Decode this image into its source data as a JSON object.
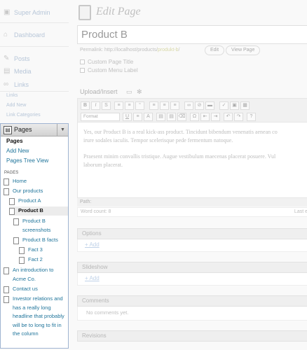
{
  "sidebar": {
    "super_admin": "Super Admin",
    "dashboard": "Dashboard",
    "posts": "Posts",
    "media": "Media",
    "links": "Links",
    "links_sub": [
      "Links",
      "Add New",
      "Link Categories"
    ],
    "pages": {
      "title": "Pages",
      "toggle_icon": "▼",
      "subnav": {
        "current": "Pages",
        "add_new": "Add New",
        "tree_view": "Pages Tree View"
      },
      "section_label": "PAGES",
      "tree": [
        {
          "label": "Home"
        },
        {
          "label": "Our products"
        },
        {
          "label": "Product A"
        },
        {
          "label": "Product B"
        },
        {
          "label": "Product B screenshots"
        },
        {
          "label": "Product B facts"
        },
        {
          "label": "Fact 3"
        },
        {
          "label": "Fact 2"
        },
        {
          "label": "An introduction to Acme Co."
        },
        {
          "label": "Contact us"
        },
        {
          "label": "Investor relations and has a really long headline that probably will be to long to fit in the column"
        }
      ]
    }
  },
  "main": {
    "heading": "Edit Page",
    "title_value": "Product B",
    "permalink_label": "Permalink:",
    "permalink_base": "http://localhost/products/",
    "permalink_slug": "produkt-b",
    "permalink_end": "/",
    "edit_btn": "Edit",
    "view_btn": "View Page",
    "custom_page_title": "Custom Page Title",
    "custom_menu_label": "Custom Menu Label",
    "upload_insert": "Upload/Insert",
    "format_select": "Format",
    "body_para1_line1": "Yes, our Product B is a real kick-ass product. Tincidunt bibendum venenatis aenean co",
    "body_para1_line2": "irure sodales iaculis. Tempor scelerisque pede fermentum natoque.",
    "body_para2_line1": "Praesent minim convallis tristique. Augue vestibulum maecenas placerat posuere. Vul",
    "body_para2_line2": "laborum placerat.",
    "path_label": "Path:",
    "word_count": "Word count: 8",
    "last_edit": "Last e",
    "options_title": "Options",
    "options_add": "+ Add",
    "slideshow_title": "Slideshow",
    "slideshow_add": "+ Add",
    "comments_title": "Comments",
    "no_comments": "No comments yet.",
    "revisions_title": "Revisions"
  }
}
